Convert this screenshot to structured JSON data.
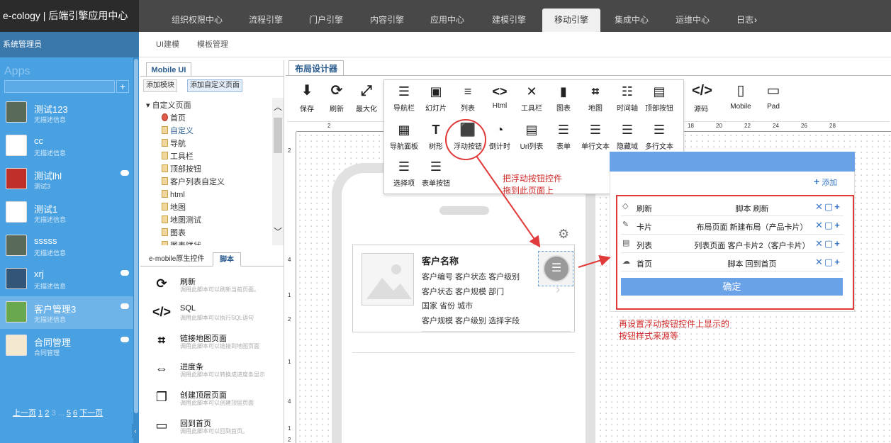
{
  "header": {
    "brand": "e-cology | 后端引擎应用中心",
    "tabs": [
      "组织权限中心",
      "流程引擎",
      "门户引擎",
      "内容引擎",
      "应用中心",
      "建模引擎",
      "移动引擎",
      "集成中心",
      "运维中心",
      "日志"
    ],
    "active_tab": "移动引擎"
  },
  "user": {
    "name": "系统管理员"
  },
  "subnav": [
    "UI建模",
    "模板管理"
  ],
  "sidebar": {
    "apps_label": "Apps",
    "apps": [
      {
        "title": "测试123",
        "desc": "无描述信息",
        "color": "#5a6a5a",
        "cloud": false
      },
      {
        "title": "cc",
        "desc": "无描述信息",
        "color": "#ffffff",
        "cloud": false
      },
      {
        "title": "测试lhl",
        "desc": "测试3",
        "color": "#c0302a",
        "cloud": true
      },
      {
        "title": "测试1",
        "desc": "无描述信息",
        "color": "#ffffff",
        "cloud": false
      },
      {
        "title": "sssss",
        "desc": "无描述信息",
        "color": "#5a6a5a",
        "cloud": false
      },
      {
        "title": "xrj",
        "desc": "无描述信息",
        "color": "#335577",
        "cloud": true
      },
      {
        "title": "客户管理3",
        "desc": "无描述信息",
        "color": "#6aa84f",
        "cloud": true
      },
      {
        "title": "合同管理",
        "desc": "合同管理",
        "color": "#f5e8d0",
        "cloud": true
      }
    ],
    "pager": {
      "prev": "上一页",
      "p1": "1",
      "p2": "2",
      "p3": "3",
      "dots": "...",
      "p5": "5",
      "p6": "6",
      "next": "下一页"
    }
  },
  "middle": {
    "tab": "Mobile UI",
    "add_module": "添加模块",
    "add_custom_page": "添加自定义页面",
    "tree_root": "自定义页面",
    "tree": [
      "首页",
      "自定义",
      "导航",
      "工具栏",
      "顶部按钮",
      "客户列表自定义",
      "html",
      "地图",
      "地图测试",
      "图表",
      "图表饼状"
    ],
    "tab2": [
      "e-mobile原生控件",
      "脚本"
    ],
    "scripts": [
      {
        "icon": "⟳",
        "title": "刷新",
        "desc": "调用此脚本可以刷新当前页面。"
      },
      {
        "icon": "</>",
        "title": "SQL",
        "desc": "调用此脚本可以执行SQL语句"
      },
      {
        "icon": "⌗",
        "title": "链接地图页面",
        "desc": "调用此脚本可以链接到地图页面"
      },
      {
        "icon": "⇔",
        "title": "进度条",
        "desc": "调用此脚本可以转换成进度条显示"
      },
      {
        "icon": "❐",
        "title": "创建顶层页面",
        "desc": "调用此脚本可以创建顶层页面"
      },
      {
        "icon": "▭",
        "title": "回到首页",
        "desc": "调用此脚本可以回到首页。"
      }
    ]
  },
  "designer": {
    "tab": "布局设计器",
    "tools_left": [
      {
        "icon": "⬇",
        "label": "保存"
      },
      {
        "icon": "⟳",
        "label": "刷新"
      },
      {
        "icon": "⤢",
        "label": "最大化"
      }
    ],
    "tools_right": [
      {
        "icon": "</>",
        "label": "源码"
      },
      {
        "icon": "▯",
        "label": "Mobile"
      },
      {
        "icon": "▭",
        "label": "Pad"
      }
    ],
    "controls_row1": [
      {
        "icon": "☰",
        "label": "导航栏"
      },
      {
        "icon": "▣",
        "label": "幻灯片"
      },
      {
        "icon": "≡",
        "label": "列表"
      },
      {
        "icon": "<>",
        "label": "Html"
      },
      {
        "icon": "✕",
        "label": "工具栏"
      },
      {
        "icon": "▮",
        "label": "图表"
      },
      {
        "icon": "⌗",
        "label": "地图"
      },
      {
        "icon": "☷",
        "label": "时间轴"
      },
      {
        "icon": "▤",
        "label": "顶部按钮"
      }
    ],
    "controls_row2": [
      {
        "icon": "▦",
        "label": "导航面板"
      },
      {
        "icon": "T",
        "label": "树形"
      },
      {
        "icon": "⬛",
        "label": "浮动按钮"
      },
      {
        "icon": "◔",
        "label": "倒计时"
      },
      {
        "icon": "▤",
        "label": "Url列表"
      },
      {
        "icon": "☰",
        "label": "表单"
      },
      {
        "icon": "☰",
        "label": "单行文本"
      },
      {
        "icon": "☰",
        "label": "隐藏域"
      },
      {
        "icon": "☰",
        "label": "多行文本"
      }
    ],
    "controls_row3": [
      {
        "icon": "☰",
        "label": "选择项"
      },
      {
        "icon": "☰",
        "label": "表单按钮"
      }
    ],
    "ruler_top": [
      "2",
      "18",
      "20",
      "22",
      "24",
      "26",
      "28"
    ],
    "ruler_left": [
      "2",
      "4",
      "1",
      "2",
      "1",
      "4",
      "1",
      "2"
    ]
  },
  "phone": {
    "name": "客户名称",
    "lines": [
      "客户编号  客户状态  客户级别",
      "客户状态  客户规模  部门",
      "国家  省份  城市",
      "客户规模  客户级别  选择字段"
    ]
  },
  "config": {
    "add": "添加",
    "rows": [
      {
        "icon": "◇",
        "name": "刷新",
        "value": "脚本 刷新"
      },
      {
        "icon": "✎",
        "name": "卡片",
        "value": "布局页面 新建布局（产品卡片）"
      },
      {
        "icon": "▤",
        "name": "列表",
        "value": "列表页面 客户卡片2（客户卡片）"
      },
      {
        "icon": "☁",
        "name": "首页",
        "value": "脚本 回到首页"
      }
    ],
    "confirm": "确定"
  },
  "notes": {
    "drag1": "把浮动按钮控件",
    "drag2": "拖到此页面上",
    "set1": "再设置浮动按钮控件上显示的",
    "set2": "按钮样式来源等"
  }
}
